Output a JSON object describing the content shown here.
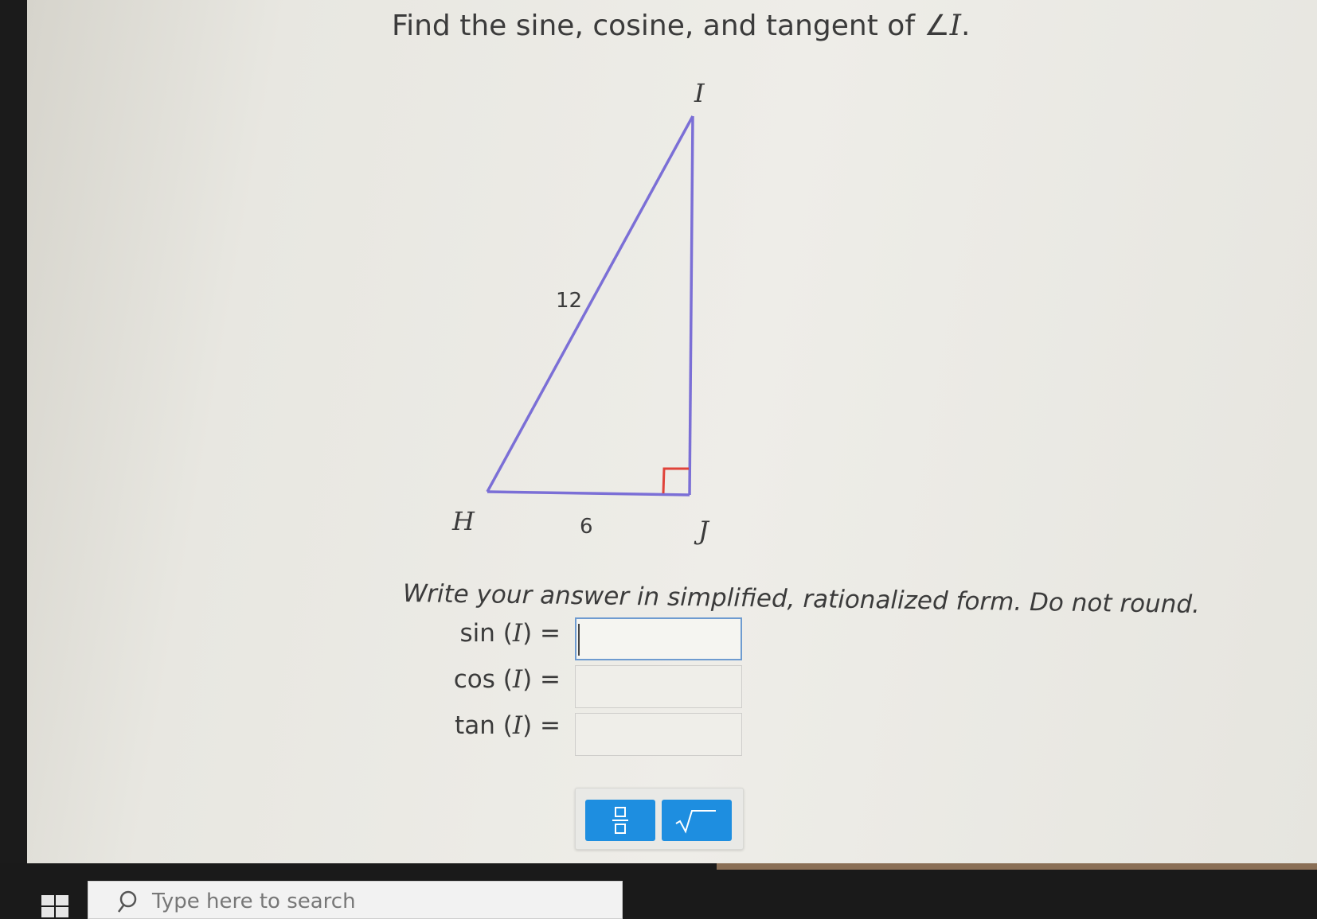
{
  "question": {
    "prefix": "Find the sine, cosine, and tangent of ∠",
    "angle": "I",
    "suffix": "."
  },
  "diagram": {
    "vertices": {
      "top": "I",
      "left": "H",
      "right": "J"
    },
    "sides": {
      "hypotenuse": "12",
      "bottom": "6"
    },
    "colors": {
      "triangle": "#7b6fd6",
      "right_angle_marker": "#e0433a"
    }
  },
  "instruction": "Write your answer in simplified, rationalized form. Do not round.",
  "answers": {
    "sin": {
      "fn": "sin",
      "arg": "I",
      "eq": "=",
      "value": ""
    },
    "cos": {
      "fn": "cos",
      "arg": "I",
      "eq": "=",
      "value": ""
    },
    "tan": {
      "fn": "tan",
      "arg": "I",
      "eq": "=",
      "value": ""
    }
  },
  "toolbar": {
    "buttons": [
      {
        "icon": "fraction-icon"
      },
      {
        "icon": "square-root-icon"
      }
    ],
    "color": "#1e8ee0"
  },
  "taskbar": {
    "search_placeholder": "Type here to search"
  }
}
